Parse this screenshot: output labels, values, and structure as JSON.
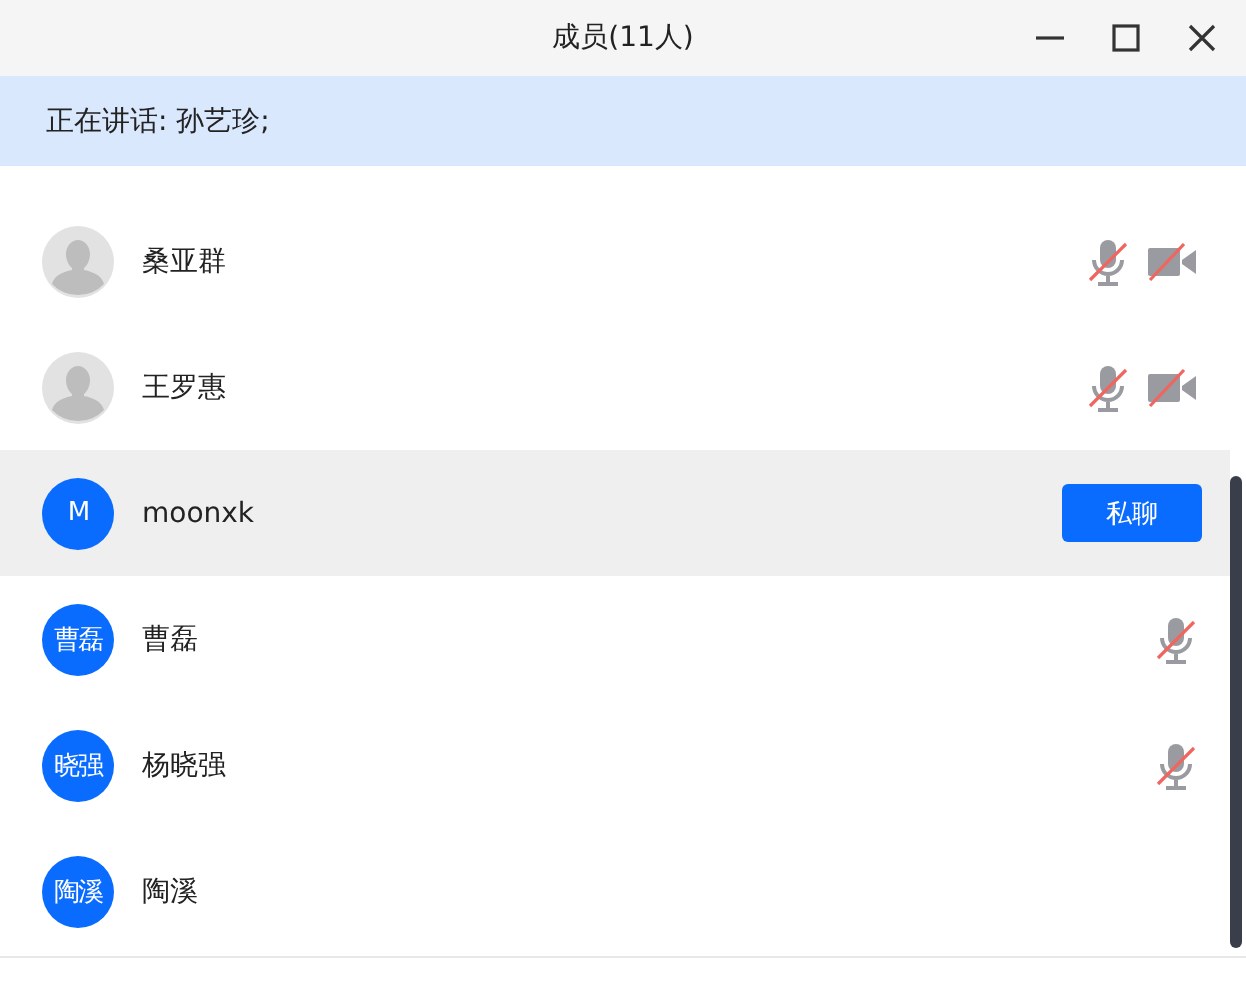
{
  "window": {
    "title": "成员(11人)"
  },
  "speaking_banner": "正在讲话: 孙艺珍;",
  "members": [
    {
      "name": "桑亚群",
      "avatar": {
        "kind": "default"
      },
      "highlighted": false,
      "mic_muted": true,
      "camera_off": true
    },
    {
      "name": "王罗惠",
      "avatar": {
        "kind": "default"
      },
      "highlighted": false,
      "mic_muted": true,
      "camera_off": true
    },
    {
      "name": "moonxk",
      "avatar": {
        "kind": "initials",
        "text": "M"
      },
      "highlighted": true,
      "mic_muted": false,
      "camera_off": false,
      "action_button": "私聊"
    },
    {
      "name": "曹磊",
      "avatar": {
        "kind": "initials",
        "text": "曹磊"
      },
      "highlighted": false,
      "mic_muted": true,
      "camera_off": false
    },
    {
      "name": "杨晓强",
      "avatar": {
        "kind": "initials",
        "text": "晓强"
      },
      "highlighted": false,
      "mic_muted": true,
      "camera_off": false
    },
    {
      "name": "陶溪",
      "avatar": {
        "kind": "initials",
        "text": "陶溪"
      },
      "highlighted": false,
      "mic_muted": false,
      "camera_off": false
    }
  ]
}
